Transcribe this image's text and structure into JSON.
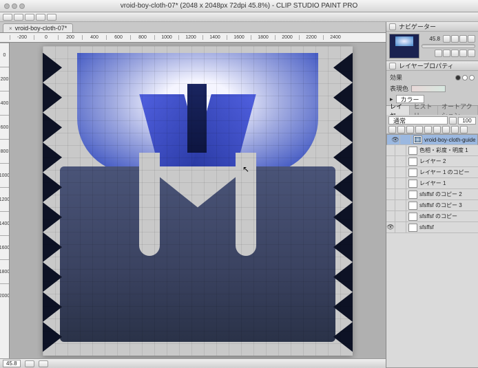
{
  "title": "vroid-boy-cloth-07* (2048 x 2048px 72dpi 45.8%)  - CLIP STUDIO PAINT PRO",
  "tab": {
    "label": "vroid-boy-cloth-07*",
    "close": "×"
  },
  "ruler_h": [
    "-200",
    "0",
    "200",
    "400",
    "600",
    "800",
    "1000",
    "1200",
    "1400",
    "1600",
    "1800",
    "2000",
    "2200",
    "2400"
  ],
  "ruler_v": [
    "0",
    "200",
    "400",
    "600",
    "800",
    "1000",
    "1200",
    "1400",
    "1600",
    "1800",
    "2000"
  ],
  "status": {
    "zoom": "45.8"
  },
  "navigator": {
    "title": "ナビゲーター",
    "zoom": "45.8"
  },
  "layer_prop": {
    "title": "レイヤープロパティ",
    "effect_label": "効果",
    "border_label": "表現色",
    "mode_label": "カラー",
    "mode_arrow": "▸"
  },
  "layers": {
    "tab1": "レイヤー",
    "tab2": "ヒストリー",
    "tab3": "オートアクション",
    "blend": "通常",
    "opacity": "100",
    "items": [
      {
        "name": "vroid-boy-cloth-guide のコピー",
        "visible": true,
        "selected": true,
        "guide": true
      },
      {
        "name": "色相・彩度・明度 1",
        "visible": false,
        "selected": false,
        "guide": false
      },
      {
        "name": "レイヤー 2",
        "visible": false,
        "selected": false,
        "guide": false
      },
      {
        "name": "レイヤー 1 のコピー",
        "visible": false,
        "selected": false,
        "guide": false
      },
      {
        "name": "レイヤー 1",
        "visible": false,
        "selected": false,
        "guide": false
      },
      {
        "name": "sfsffsf のコピー 2",
        "visible": false,
        "selected": false,
        "guide": false
      },
      {
        "name": "sfsffsf のコピー 3",
        "visible": false,
        "selected": false,
        "guide": false
      },
      {
        "name": "sfsffsf のコピー",
        "visible": false,
        "selected": false,
        "guide": false
      },
      {
        "name": "sfsffsf",
        "visible": true,
        "selected": false,
        "guide": false
      }
    ]
  }
}
